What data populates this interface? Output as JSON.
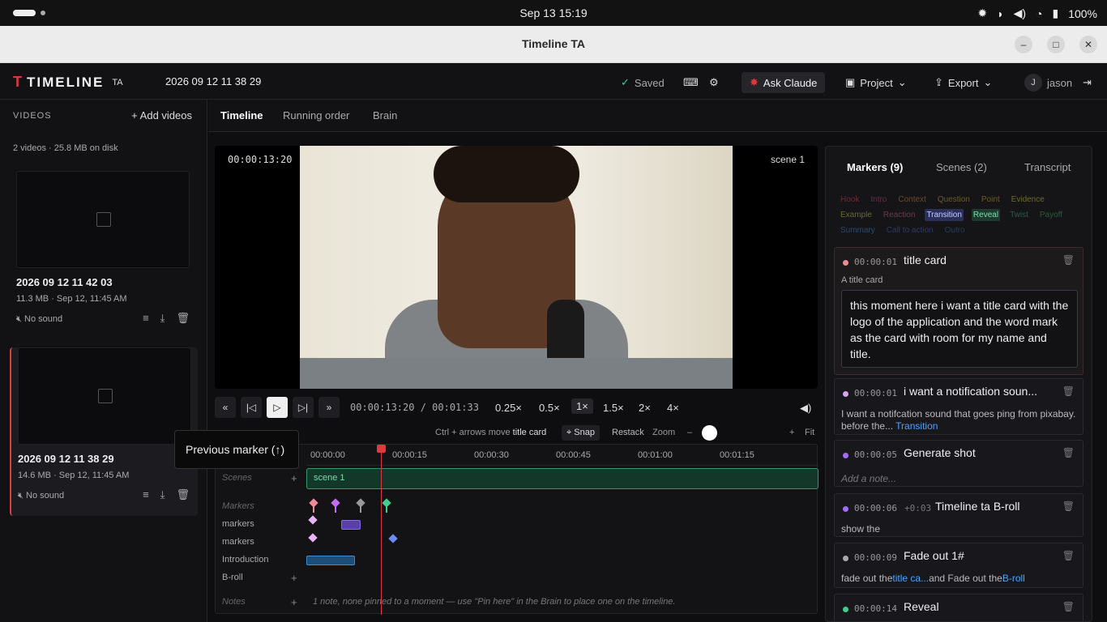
{
  "system": {
    "clock": "Sep 13  15:19",
    "battery": "100%"
  },
  "window": {
    "title": "Timeline TA",
    "minimize": "–",
    "maximize": "□",
    "close": "✕"
  },
  "app": {
    "logo_word": "TIMELINE",
    "logo_sub": "TA",
    "project_name": "2026 09 12 11 38 29",
    "saved": "Saved",
    "ask": "Ask Claude",
    "project_menu": "Project",
    "export_menu": "Export",
    "user_initial": "J",
    "user": "jason"
  },
  "sidebar": {
    "heading": "VIDEOS",
    "add_label": "Add videos",
    "summary": "2 videos · 25.8 MB on disk",
    "videos": [
      {
        "name": "2026 09 12 11 42 03",
        "meta": "11.3 MB · Sep 12, 11:45 AM",
        "sound": "No sound"
      },
      {
        "name": "2026 09 12 11 38 29",
        "meta": "14.6 MB · Sep 12, 11:45 AM",
        "sound": "No sound"
      }
    ]
  },
  "tabs": [
    "Timeline",
    "Running order",
    "Brain"
  ],
  "player": {
    "timecode": "00:00:13:20",
    "scene": "scene 1",
    "position": "00:00:13:20 / 00:01:33",
    "speeds": [
      "0.25×",
      "0.5×",
      "1×",
      "1.5×",
      "2×",
      "4×"
    ],
    "active_speed": "1×"
  },
  "timeline": {
    "hint_pre": "Ctrl + arrows move ",
    "hint_target": "title card",
    "snap": "Snap",
    "restack": "Restack",
    "zoom": "Zoom",
    "zoom_minus": "–",
    "zoom_plus": "+",
    "fit": "Fit",
    "ruler": [
      "00:00:00",
      "00:00:15",
      "00:00:30",
      "00:00:45",
      "00:01:00",
      "00:01:15"
    ],
    "lanes": {
      "scenes": "Scenes",
      "markers_header": "Markers",
      "markers1": "markers",
      "markers2": "markers",
      "intro": "Introduction",
      "broll": "B-roll",
      "notes": "Notes"
    },
    "scene_label": "scene 1",
    "notes_text": "1 note, none pinned to a moment — use \"Pin here\" in the Brain to place one on the timeline."
  },
  "tooltip": "Previous marker (↑)",
  "panel": {
    "tabs": [
      "Markers (9)",
      "Scenes (2)",
      "Transcript"
    ],
    "chips": [
      {
        "label": "Hook",
        "color": "#6b2a35",
        "bg": "transparent"
      },
      {
        "label": "Intro",
        "color": "#6b2a4a",
        "bg": "transparent"
      },
      {
        "label": "Context",
        "color": "#6b4a2a",
        "bg": "transparent"
      },
      {
        "label": "Question",
        "color": "#6b5a2a",
        "bg": "transparent"
      },
      {
        "label": "Point",
        "color": "#6b5a2a",
        "bg": "transparent"
      },
      {
        "label": "Evidence",
        "color": "#6b6a2a",
        "bg": "transparent"
      },
      {
        "label": "Example",
        "color": "#6b6a2a",
        "bg": "transparent"
      },
      {
        "label": "Reaction",
        "color": "#6b3a4a",
        "bg": "transparent"
      },
      {
        "label": "Transition",
        "color": "#c9cbff",
        "bg": "#2a2e5a"
      },
      {
        "label": "Reveal",
        "color": "#7ee0b0",
        "bg": "#1c3a2e"
      },
      {
        "label": "Twist",
        "color": "#2a5a4a",
        "bg": "transparent"
      },
      {
        "label": "Payoff",
        "color": "#2a5a3a",
        "bg": "transparent"
      },
      {
        "label": "Summary",
        "color": "#2a4a6b",
        "bg": "transparent"
      },
      {
        "label": "Call to action",
        "color": "#2a3a6b",
        "bg": "transparent"
      },
      {
        "label": "Outro",
        "color": "#2a3a5a",
        "bg": "transparent"
      }
    ],
    "markers": [
      {
        "time": "00:00:01",
        "title": "title card",
        "note": "A title card",
        "dot": "#f28b95",
        "text": "this moment here i want a title card with the logo of the application and the word mark as the card with room for my name and title."
      },
      {
        "time": "00:00:01",
        "title": "i want a notification soun...",
        "dot": "#d8a4f5",
        "note": "I want a notifcation sound that goes ping from pixabay. before the...",
        "note2": "Transition"
      },
      {
        "time": "00:00:05",
        "title": "Generate shot",
        "dot": "#a46bf5",
        "note": "Add a note..."
      },
      {
        "time": "00:00:06",
        "offset": "+0:03",
        "title": "Timeline ta B-roll",
        "dot": "#a46bf5",
        "note": "show the"
      },
      {
        "time": "00:00:09",
        "title": "Fade out 1#",
        "dot": "#aaaaaa",
        "note_pre": "fade out the",
        "link1": "title ca...",
        "note_mid": "and Fade out the",
        "link2": "B-roll"
      },
      {
        "time": "00:00:14",
        "title": "Reveal",
        "dot": "#3ecf8e"
      }
    ]
  }
}
